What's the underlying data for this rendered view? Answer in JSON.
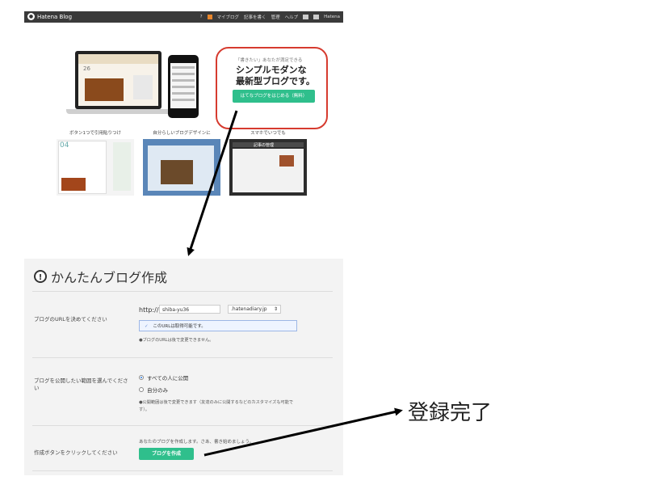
{
  "landing": {
    "brand": "Hatena Blog",
    "nav": [
      "マイブログ",
      "記事を書く",
      "管理",
      "ヘルプ",
      "Hatena"
    ],
    "tagline": "「書きたい」あなたが満足できる",
    "headline": "シンプルモダンな\n最新型ブログです。",
    "start_button": "はてなブログをはじめる（無料）",
    "laptop_date": "26",
    "features": [
      {
        "title": "ボタン1つで引用貼りつけ",
        "num": "04"
      },
      {
        "title": "自分らしいブログデザインに"
      },
      {
        "title": "スマホでいつでも",
        "screen_title": "記事の管理"
      }
    ]
  },
  "form": {
    "title": "かんたんブログ作成",
    "url_label": "ブログのURLを決めてください",
    "url_prefix": "http://",
    "url_value": "shiba-yu36",
    "domain": ".hatenadiary.jp",
    "availability": "このURLは取得可能です。",
    "url_note": "●ブログのURLは後で変更できません。",
    "publish_label": "ブログを公開したい範囲を選んでください",
    "options": [
      {
        "label": "すべての人に公開",
        "selected": true
      },
      {
        "label": "自分のみ",
        "selected": false
      }
    ],
    "publish_note": "●公開範囲は後で変更できます（友達のみに公開するなどのカスタマイズも可能です）。",
    "create_label": "作成ボタンをクリックしてください",
    "create_desc": "あなたのブログを作成します。さあ、書き始めましょう。",
    "create_button": "ブログを作成"
  },
  "annotation": {
    "done_label": "登録完了",
    "callout_color": "#d63b2f"
  },
  "colors": {
    "accent_green": "#2fbf8c",
    "topbar": "#3a3a3a"
  }
}
